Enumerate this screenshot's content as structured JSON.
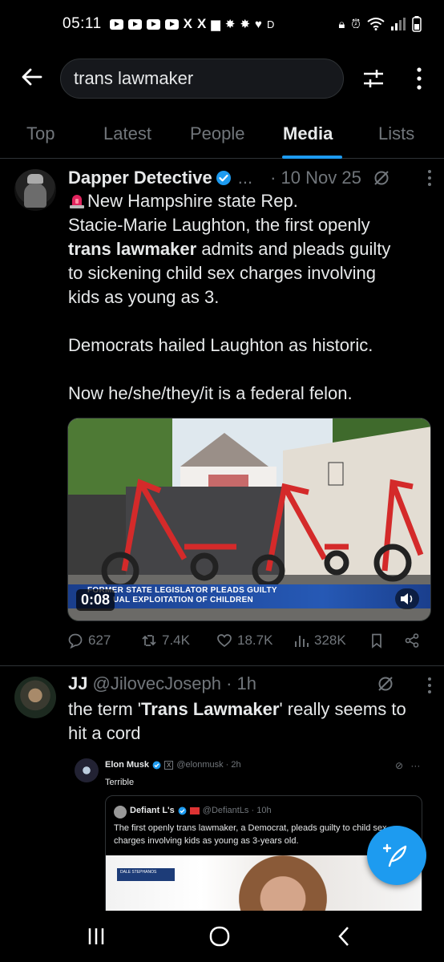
{
  "status_bar": {
    "time": "05:11",
    "letters": [
      "X",
      "X",
      "D"
    ]
  },
  "search": {
    "query": "trans lawmaker"
  },
  "tabs": [
    {
      "label": "Top"
    },
    {
      "label": "Latest"
    },
    {
      "label": "People"
    },
    {
      "label": "Media"
    },
    {
      "label": "Lists"
    }
  ],
  "post1": {
    "name": "Dapper Detective",
    "dots": "...",
    "date": "· 10 Nov 25",
    "text_line1": "New Hampshire state Rep.",
    "text_line2": "Stacie-Marie Laughton, the first openly",
    "text_bold": "trans lawmaker",
    "text_after_bold": " admits and pleads guilty",
    "text_line4": "to sickening child sex charges involving",
    "text_line5": "kids as young as 3.",
    "text_para2": "Democrats hailed Laughton as historic.",
    "text_para3": "Now he/she/they/it is a federal felon.",
    "video": {
      "duration": "0:08",
      "lower_third_1": "FORMER STATE LEGISLATOR PLEADS GUILTY",
      "lower_third_2": "UAL EXPLOITATION OF CHILDREN"
    },
    "actions": {
      "replies": "627",
      "reposts": "7.4K",
      "likes": "18.7K",
      "views": "328K"
    }
  },
  "post2": {
    "name": "JJ",
    "handle": "@JilovecJoseph · 1h",
    "text_pre": "the term '",
    "text_bold": "Trans Lawmaker",
    "text_post": "' really seems to hit a cord",
    "embed": {
      "name": "Elon Musk",
      "handle": "@elonmusk · 2h",
      "text": "Terrible",
      "quote": {
        "name": "Defiant L's",
        "handle": "@DefiantLs · 10h",
        "text": "The first openly trans lawmaker, a Democrat, pleads guilty to child sex charges involving kids as young as 3-years old.",
        "banner": "DALE STEPHANOS"
      }
    }
  },
  "colors": {
    "accent": "#1d9bf0",
    "background": "#000000",
    "muted": "#71767b",
    "text": "#e7e9ea"
  }
}
